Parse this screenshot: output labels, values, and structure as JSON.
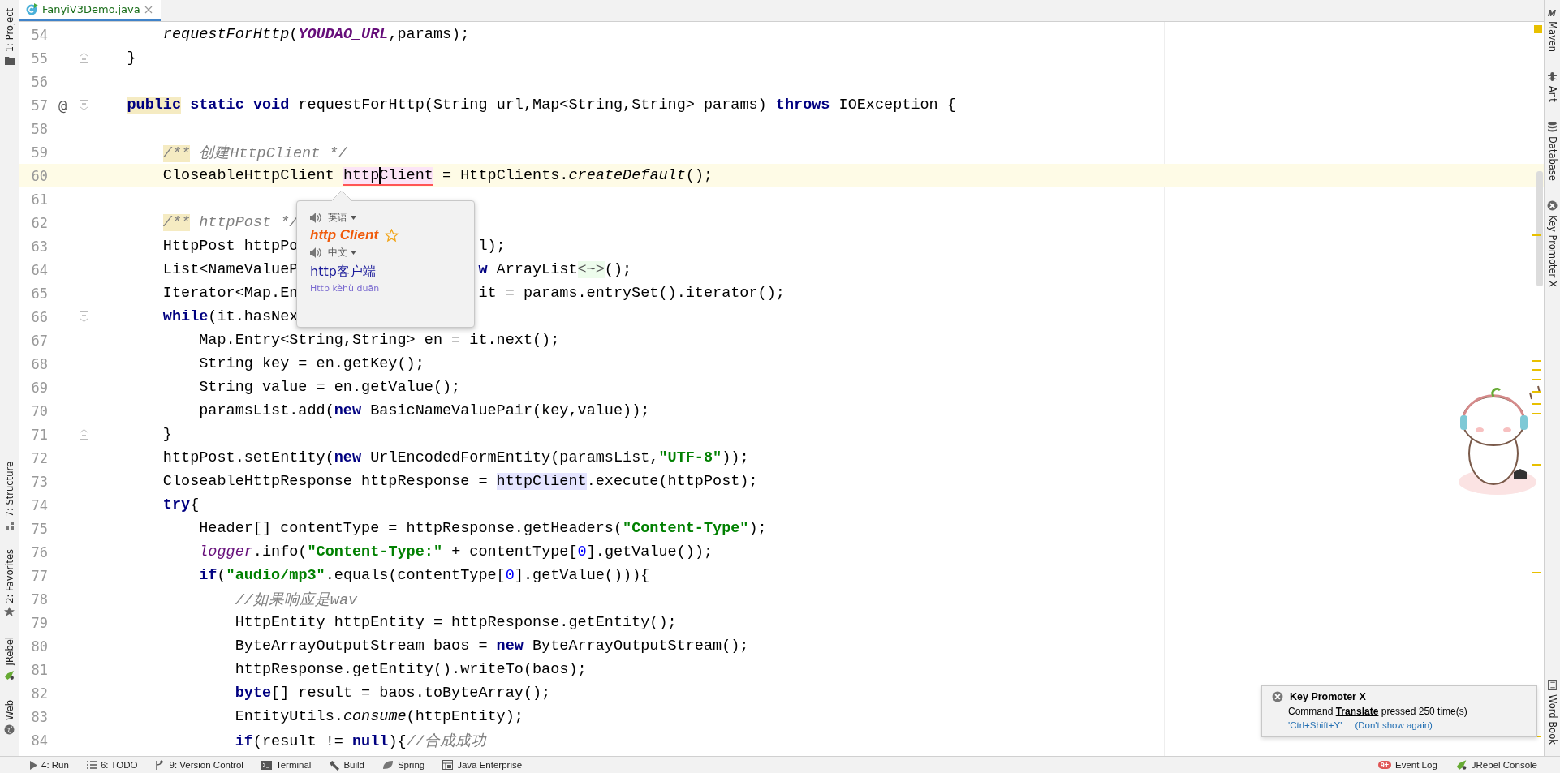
{
  "left_strip": {
    "top": [
      {
        "label": "1: Project",
        "kind": "folder"
      }
    ],
    "bottom": [
      {
        "label": "7: Structure",
        "kind": "structure"
      },
      {
        "label": "2: Favorites",
        "kind": "star"
      },
      {
        "label": "JRebel",
        "kind": "rocket"
      },
      {
        "label": "Web",
        "kind": "globe"
      }
    ]
  },
  "tabs": [
    {
      "label": "FanyiV3Demo.java",
      "selected": true
    }
  ],
  "lines": [
    {
      "number": "54",
      "current": false,
      "tokens": [
        {
          "t": "        requestForHttp",
          "kind": "italic"
        },
        {
          "t": "(",
          "kind": "plain"
        },
        {
          "t": "YOUDAO_URL",
          "kind": "field"
        },
        {
          "t": ",params);",
          "kind": "plain"
        }
      ]
    },
    {
      "number": "55",
      "current": false,
      "fold": {
        "kind": "end"
      },
      "tokens": [
        {
          "t": "    }",
          "kind": "plain"
        }
      ]
    },
    {
      "number": "56",
      "current": false
    },
    {
      "number": "57",
      "current": false,
      "annotation": "@",
      "fold": {
        "kind": "start"
      },
      "tokens": [
        {
          "t": "    public",
          "kind": "kw-marked"
        },
        {
          "t": " static",
          "kind": "kw"
        },
        {
          "t": " void",
          "kind": "kw"
        },
        {
          "t": " requestForHttp(String url,Map<String,String> params) ",
          "kind": "plain"
        },
        {
          "t": "throws",
          "kind": "kw"
        },
        {
          "t": " IOException {",
          "kind": "plain"
        }
      ]
    },
    {
      "number": "58",
      "current": false
    },
    {
      "number": "59",
      "current": false,
      "tokens": [
        {
          "t": "        /**",
          "kind": "comment-marked"
        },
        {
          "t": " 创建HttpClient */",
          "kind": "comment"
        }
      ]
    },
    {
      "number": "60",
      "current": true,
      "tokens": [
        {
          "t": "        CloseableHttpClient ",
          "kind": "plain"
        },
        {
          "t": "http",
          "kind": "write"
        },
        {
          "t": "Client",
          "kind": "write-caret"
        },
        {
          "t": " = HttpClients.",
          "kind": "plain"
        },
        {
          "t": "createDefault",
          "kind": "italic"
        },
        {
          "t": "();",
          "kind": "plain"
        }
      ]
    },
    {
      "number": "61",
      "current": false
    },
    {
      "number": "62",
      "current": false,
      "tokens": [
        {
          "t": "        /**",
          "kind": "comment-marked"
        },
        {
          "t": " httpPost */",
          "kind": "comment"
        }
      ]
    },
    {
      "number": "63",
      "current": false,
      "tokens": [
        {
          "t": "        HttpPost httpPo",
          "kind": "plain"
        }
      ],
      "tail": [
        {
          "t": "l);",
          "kind": "plain"
        }
      ]
    },
    {
      "number": "64",
      "current": false,
      "tokens": [
        {
          "t": "        List<NameValueP",
          "kind": "plain"
        }
      ],
      "tail": [
        {
          "t": "w",
          "kind": "kw"
        },
        {
          "t": " ArrayList",
          "kind": "plain"
        },
        {
          "t": "<~>",
          "kind": "diamond"
        },
        {
          "t": "();",
          "kind": "plain"
        }
      ]
    },
    {
      "number": "65",
      "current": false,
      "tokens": [
        {
          "t": "        Iterator<Map.En",
          "kind": "plain"
        }
      ],
      "tail": [
        {
          "t": "it = params.entrySet().iterator();",
          "kind": "plain"
        }
      ]
    },
    {
      "number": "66",
      "current": false,
      "fold": {
        "kind": "start"
      },
      "tokens": [
        {
          "t": "        while",
          "kind": "kw"
        },
        {
          "t": "(it.hasNex",
          "kind": "plain"
        }
      ]
    },
    {
      "number": "67",
      "current": false,
      "tokens": [
        {
          "t": "            Map.Entry<String,String> en = it.next();",
          "kind": "plain"
        }
      ]
    },
    {
      "number": "68",
      "current": false,
      "tokens": [
        {
          "t": "            String key = en.getKey();",
          "kind": "plain"
        }
      ]
    },
    {
      "number": "69",
      "current": false,
      "tokens": [
        {
          "t": "            String value = en.getValue();",
          "kind": "plain"
        }
      ]
    },
    {
      "number": "70",
      "current": false,
      "tokens": [
        {
          "t": "            paramsList.add(",
          "kind": "plain"
        },
        {
          "t": "new",
          "kind": "kw"
        },
        {
          "t": " BasicNameValuePair(key,value));",
          "kind": "plain"
        }
      ]
    },
    {
      "number": "71",
      "current": false,
      "fold": {
        "kind": "end"
      },
      "tokens": [
        {
          "t": "        }",
          "kind": "plain"
        }
      ]
    },
    {
      "number": "72",
      "current": false,
      "tokens": [
        {
          "t": "        httpPost.setEntity(",
          "kind": "plain"
        },
        {
          "t": "new",
          "kind": "kw"
        },
        {
          "t": " UrlEncodedFormEntity(paramsList,",
          "kind": "plain"
        },
        {
          "t": "\"UTF-8\"",
          "kind": "string"
        },
        {
          "t": "));",
          "kind": "plain"
        }
      ]
    },
    {
      "number": "73",
      "current": false,
      "tokens": [
        {
          "t": "        CloseableHttpResponse httpResponse = ",
          "kind": "plain"
        },
        {
          "t": "httpClient",
          "kind": "read"
        },
        {
          "t": ".execute(httpPost);",
          "kind": "plain"
        }
      ]
    },
    {
      "number": "74",
      "current": false,
      "tokens": [
        {
          "t": "        try",
          "kind": "kw"
        },
        {
          "t": "{",
          "kind": "plain"
        }
      ]
    },
    {
      "number": "75",
      "current": false,
      "tokens": [
        {
          "t": "            Header[] contentType = httpResponse.getHeaders(",
          "kind": "plain"
        },
        {
          "t": "\"Content-Type\"",
          "kind": "string"
        },
        {
          "t": ");",
          "kind": "plain"
        }
      ]
    },
    {
      "number": "76",
      "current": false,
      "tokens": [
        {
          "t": "            logger",
          "kind": "field-plain"
        },
        {
          "t": ".info(",
          "kind": "plain"
        },
        {
          "t": "\"Content-Type:\"",
          "kind": "string"
        },
        {
          "t": " + contentType[",
          "kind": "plain"
        },
        {
          "t": "0",
          "kind": "number"
        },
        {
          "t": "].getValue());",
          "kind": "plain"
        }
      ]
    },
    {
      "number": "77",
      "current": false,
      "tokens": [
        {
          "t": "            if",
          "kind": "kw"
        },
        {
          "t": "(",
          "kind": "plain"
        },
        {
          "t": "\"audio/mp3\"",
          "kind": "string"
        },
        {
          "t": ".equals(contentType[",
          "kind": "plain"
        },
        {
          "t": "0",
          "kind": "number"
        },
        {
          "t": "].getValue())){",
          "kind": "plain"
        }
      ]
    },
    {
      "number": "78",
      "current": false,
      "tokens": [
        {
          "t": "                //如果响应是wav",
          "kind": "comment"
        }
      ]
    },
    {
      "number": "79",
      "current": false,
      "tokens": [
        {
          "t": "                HttpEntity httpEntity = httpResponse.getEntity();",
          "kind": "plain"
        }
      ]
    },
    {
      "number": "80",
      "current": false,
      "tokens": [
        {
          "t": "                ByteArrayOutputStream baos = ",
          "kind": "plain"
        },
        {
          "t": "new",
          "kind": "kw"
        },
        {
          "t": " ByteArrayOutputStream();",
          "kind": "plain"
        }
      ]
    },
    {
      "number": "81",
      "current": false,
      "tokens": [
        {
          "t": "                httpResponse.getEntity().writeTo(baos);",
          "kind": "plain"
        }
      ]
    },
    {
      "number": "82",
      "current": false,
      "tokens": [
        {
          "t": "                byte",
          "kind": "kw"
        },
        {
          "t": "[] result = baos.toByteArray();",
          "kind": "plain"
        }
      ]
    },
    {
      "number": "83",
      "current": false,
      "tokens": [
        {
          "t": "                EntityUtils.",
          "kind": "plain"
        },
        {
          "t": "consume",
          "kind": "italic"
        },
        {
          "t": "(httpEntity);",
          "kind": "plain"
        }
      ]
    },
    {
      "number": "84",
      "current": false,
      "tokens": [
        {
          "t": "                if",
          "kind": "kw"
        },
        {
          "t": "(result != ",
          "kind": "plain"
        },
        {
          "t": "null",
          "kind": "kw"
        },
        {
          "t": "){",
          "kind": "plain"
        },
        {
          "t": "//合成成功",
          "kind": "comment"
        }
      ]
    }
  ],
  "translation_popup": {
    "source_language": "英语",
    "source_text": "http Client",
    "starred": false,
    "target_language": "中文",
    "translation": "http客户端",
    "pinyin": "Http kèhù duān"
  },
  "right_strip": {
    "top": [
      {
        "label": "Maven",
        "kind": "maven"
      },
      {
        "label": "Ant",
        "kind": "ant"
      },
      {
        "label": "Database",
        "kind": "database"
      },
      {
        "label": "Key Promoter X",
        "kind": "keypromoter"
      }
    ],
    "bottom": [
      {
        "label": "Word Book",
        "kind": "book"
      }
    ]
  },
  "notification": {
    "title": "Key Promoter X",
    "message": "Command **Translate** pressed 250 time(s)",
    "links": [
      "'Ctrl+Shift+Y'",
      "(Don't show again)"
    ]
  },
  "status_bar": {
    "left": [
      {
        "label": "4: Run",
        "kind": "run"
      },
      {
        "label": "6: TODO",
        "kind": "todo"
      },
      {
        "label": "9: Version Control",
        "kind": "vcs"
      },
      {
        "label": "Terminal",
        "kind": "terminal"
      },
      {
        "label": "Build",
        "kind": "build"
      },
      {
        "label": "Spring",
        "kind": "spring"
      },
      {
        "label": "Java Enterprise",
        "kind": "javaee"
      }
    ],
    "right": [
      {
        "label": "Event Log",
        "kind": "eventlog",
        "badge": "9+"
      },
      {
        "label": "JRebel Console",
        "kind": "jrebel"
      }
    ]
  }
}
